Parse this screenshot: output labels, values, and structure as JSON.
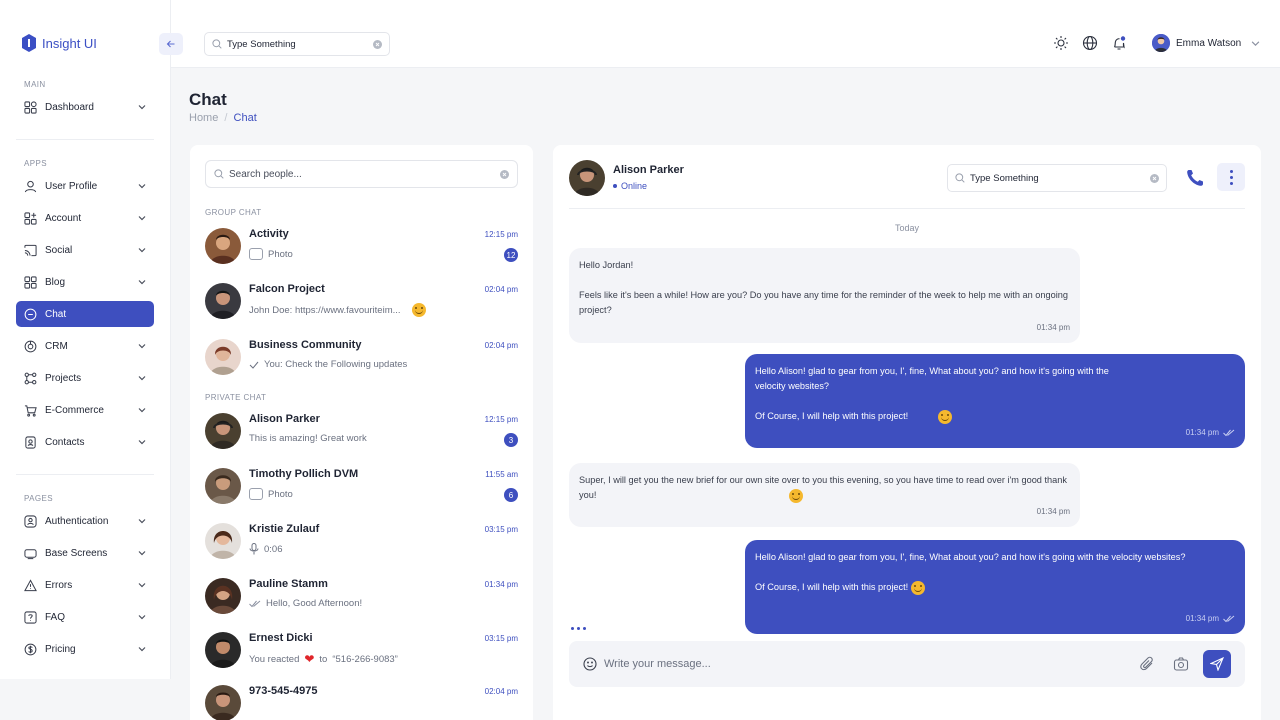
{
  "app": {
    "title": "Insight UI"
  },
  "sidebar": {
    "sections": {
      "main": "MAIN",
      "apps": "APPS",
      "pages": "PAGES"
    },
    "main_items": [
      {
        "label": "Dashboard",
        "icon": "grid-icon"
      }
    ],
    "apps_items": [
      {
        "label": "User Profile",
        "icon": "user-icon"
      },
      {
        "label": "Account",
        "icon": "account-icon"
      },
      {
        "label": "Social",
        "icon": "cast-icon"
      },
      {
        "label": "Blog",
        "icon": "blog-icon"
      },
      {
        "label": "Chat",
        "icon": "chat-icon",
        "active": true
      },
      {
        "label": "CRM",
        "icon": "crm-icon"
      },
      {
        "label": "Projects",
        "icon": "projects-icon"
      },
      {
        "label": "E-Commerce",
        "icon": "cart-icon"
      },
      {
        "label": "Contacts",
        "icon": "contacts-icon"
      }
    ],
    "pages_items": [
      {
        "label": "Authentication",
        "icon": "auth-icon"
      },
      {
        "label": "Base Screens",
        "icon": "screen-icon"
      },
      {
        "label": "Errors",
        "icon": "warning-icon"
      },
      {
        "label": "FAQ",
        "icon": "faq-icon"
      },
      {
        "label": "Pricing",
        "icon": "dollar-icon"
      }
    ]
  },
  "topbar": {
    "search_value": "Type Something",
    "user_name": "Emma Watson"
  },
  "page": {
    "title": "Chat",
    "breadcrumb_home": "Home",
    "breadcrumb_sep": "/",
    "breadcrumb_current": "Chat"
  },
  "chat_list": {
    "search_placeholder": "Search people...",
    "group_label": "GROUP CHAT",
    "private_label": "PRIVATE CHAT",
    "group": [
      {
        "name": "Activity",
        "preview": "Photo",
        "time": "12:15 pm",
        "badge": "12",
        "type": "photo"
      },
      {
        "name": "Falcon Project",
        "preview": "John Doe: https://www.favouriteim...",
        "time": "02:04 pm",
        "type": "emoji"
      },
      {
        "name": "Business Community",
        "preview": "You: Check the Following updates",
        "time": "02:04 pm",
        "type": "check"
      }
    ],
    "private": [
      {
        "name": "Alison Parker",
        "preview": "This is amazing! Great work",
        "time": "12:15 pm",
        "badge": "3",
        "type": "text"
      },
      {
        "name": "Timothy Pollich DVM",
        "preview": "Photo",
        "time": "11:55 am",
        "badge": "6",
        "type": "photo"
      },
      {
        "name": "Kristie Zulauf",
        "preview": "0:06",
        "time": "03:15 pm",
        "type": "mic"
      },
      {
        "name": "Pauline Stamm",
        "preview": "Hello, Good Afternoon!",
        "time": "01:34 pm",
        "type": "doublecheck"
      },
      {
        "name": "Ernest Dicki",
        "preview_a": "You reacted",
        "preview_b": "to",
        "preview_c": "“516-266-9083”",
        "time": "03:15 pm",
        "type": "heart"
      },
      {
        "name": "973-545-4975",
        "time": "02:04 pm",
        "type": "text"
      }
    ]
  },
  "conversation": {
    "contact_name": "Alison Parker",
    "status": "Online",
    "search_value": "Type Something",
    "day_label": "Today",
    "messages": [
      {
        "dir": "in",
        "lines": [
          "Hello Jordan!",
          "",
          "Feels like it's been a while! How are you? Do you have any time for the reminder of the week to help me with an ongoing project?"
        ],
        "time": "01:34 pm"
      },
      {
        "dir": "out",
        "lines": [
          "Hello Alison! glad to gear from you, I', fine, What about you? and how it's going with the velocity websites?",
          "",
          "Of Course, I will help with this project!"
        ],
        "time": "01:34 pm"
      },
      {
        "dir": "in",
        "lines": [
          "Super, I will get you the new brief for our own site over to you this evening, so you have time to read over i'm good thank you!"
        ],
        "time": "01:34 pm"
      },
      {
        "dir": "out",
        "lines": [
          "Hello Alison! glad to gear from you, I', fine, What about you? and how it's going with the velocity websites?",
          "",
          "Of Course, I will help with this project!"
        ],
        "time": "01:34 pm"
      }
    ],
    "composer_placeholder": "Write your message..."
  },
  "colors": {
    "accent": "#3e4fbf",
    "badge": "#3e4fbf",
    "background": "#f5f6f8"
  }
}
